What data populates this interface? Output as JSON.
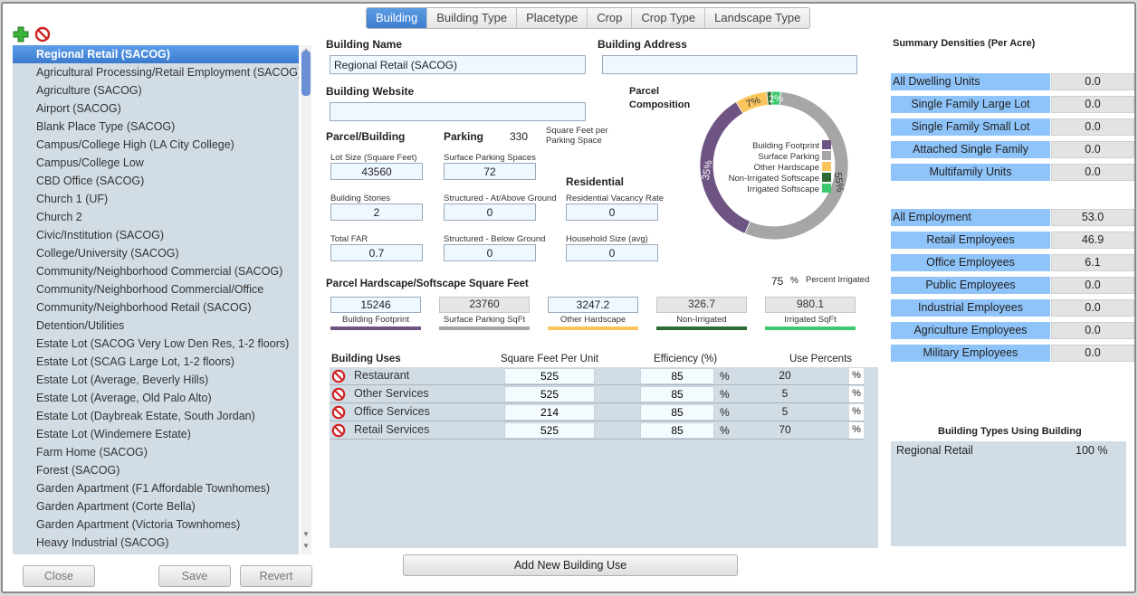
{
  "tabs": [
    "Building",
    "Building Type",
    "Placetype",
    "Crop",
    "Crop Type",
    "Landscape Type"
  ],
  "colors": {
    "accent": "#3d7fcf",
    "footprint": "#6e5482",
    "surface_parking": "#a6a6a6",
    "other_hardscape": "#fbc55d",
    "non_irrigated": "#2d6a36",
    "irrigated": "#3dc96e",
    "list_bg": "#d2dce4",
    "summary_key": "#8fc4fa"
  },
  "toolbar": {
    "add_icon": "plus-icon",
    "remove_icon": "no-entry-icon"
  },
  "list": {
    "items": [
      "Regional Retail (SACOG)",
      "Agricultural Processing/Retail Employment (SACOG)",
      "Agriculture (SACOG)",
      "Airport (SACOG)",
      "Blank Place Type (SACOG)",
      "Campus/College High (LA City College)",
      "Campus/College Low",
      "CBD Office (SACOG)",
      "Church 1 (UF)",
      "Church 2",
      "Civic/Institution (SACOG)",
      "College/University (SACOG)",
      "Community/Neighborhood Commercial (SACOG)",
      "Community/Neighborhood Commercial/Office",
      "Community/Neighborhood Retail (SACOG)",
      "Detention/Utilities",
      "Estate Lot (SACOG Very Low Den Res, 1-2 floors)",
      "Estate Lot (SCAG Large Lot, 1-2 floors)",
      "Estate Lot (Average, Beverly Hills)",
      "Estate Lot (Average, Old Palo Alto)",
      "Estate Lot (Daybreak Estate, South Jordan)",
      "Estate Lot (Windemere Estate)",
      "Farm Home (SACOG)",
      "Forest (SACOG)",
      "Garden Apartment (F1 Affordable Townhomes)",
      "Garden Apartment (Corte Bella)",
      "Garden Apartment (Victoria Townhomes)",
      "Heavy Industrial (SACOG)"
    ],
    "selected_index": 0
  },
  "footer": {
    "close": "Close",
    "save": "Save",
    "revert": "Revert"
  },
  "building": {
    "name_label": "Building Name",
    "name": "Regional Retail (SACOG)",
    "address_label": "Building Address",
    "address": "",
    "website_label": "Building Website",
    "website": "",
    "parcel_building_label": "Parcel/Building",
    "lot_size_label": "Lot Size (Square Feet)",
    "lot_size": "43560",
    "stories_label": "Building Stories",
    "stories": "2",
    "far_label": "Total FAR",
    "far": "0.7",
    "parking_label": "Parking",
    "parking_sqft": "330",
    "parking_unit": "Square Feet per Parking Space",
    "surface_spaces_label": "Surface Parking Spaces",
    "surface_spaces": "72",
    "structured_above_label": "Structured - At/Above Ground",
    "structured_above": "0",
    "structured_below_label": "Structured - Below Ground",
    "structured_below": "0",
    "residential_label": "Residential",
    "vacancy_label": "Residential Vacancy Rate",
    "vacancy": "0",
    "household_label": "Household Size (avg)",
    "household": "0"
  },
  "composition": {
    "title": "Parcel Composition",
    "legend": [
      "Building Footprint",
      "Surface Parking",
      "Other Hardscape",
      "Non-Irrigated Softscape",
      "Irrigated Softscape"
    ],
    "slices": [
      {
        "label": "Building Footprint",
        "value": 35
      },
      {
        "label": "Surface Parking",
        "value": 55
      },
      {
        "label": "Other Hardscape",
        "value": 7
      },
      {
        "label": "Non-Irrigated Softscape",
        "value": 1
      },
      {
        "label": "Irrigated Softscape",
        "value": 2
      }
    ],
    "pct_labels": {
      "footprint": "35%",
      "parking": "55%",
      "hardscape": "7%",
      "irrigated": "2%"
    }
  },
  "hardscape": {
    "title": "Parcel Hardscape/Softscape Square Feet",
    "percent_irrigated": "75",
    "percent_sign": "%",
    "percent_irrigated_label": "Percent Irrigated",
    "items": [
      {
        "label": "Building Footprint",
        "value": "15246"
      },
      {
        "label": "Surface Parking SqFt",
        "value": "23760"
      },
      {
        "label": "Other Hardscape",
        "value": "3247.2"
      },
      {
        "label": "Non-Irrigated",
        "value": "326.7"
      },
      {
        "label": "Irrigated SqFt",
        "value": "980.1"
      }
    ]
  },
  "uses": {
    "headers": [
      "Building Uses",
      "Square Feet Per Unit",
      "Efficiency (%)",
      "Use Percents"
    ],
    "rows": [
      {
        "name": "Restaurant",
        "sqft": "525",
        "eff": "85",
        "pct": "20"
      },
      {
        "name": "Other Services",
        "sqft": "525",
        "eff": "85",
        "pct": "5"
      },
      {
        "name": "Office Services",
        "sqft": "214",
        "eff": "85",
        "pct": "5"
      },
      {
        "name": "Retail Services",
        "sqft": "525",
        "eff": "85",
        "pct": "70"
      }
    ],
    "percent_sign": "%",
    "add_button": "Add New Building Use"
  },
  "summary": {
    "title": "Summary Densities (Per Acre)",
    "dwelling": [
      {
        "label": "All Dwelling Units",
        "value": "0.0"
      },
      {
        "label": "Single Family Large Lot",
        "value": "0.0"
      },
      {
        "label": "Single Family Small Lot",
        "value": "0.0"
      },
      {
        "label": "Attached Single Family",
        "value": "0.0"
      },
      {
        "label": "Multifamily Units",
        "value": "0.0"
      }
    ],
    "employment": [
      {
        "label": "All Employment",
        "value": "53.0"
      },
      {
        "label": "Retail Employees",
        "value": "46.9"
      },
      {
        "label": "Office Employees",
        "value": "6.1"
      },
      {
        "label": "Public Employees",
        "value": "0.0"
      },
      {
        "label": "Industrial Employees",
        "value": "0.0"
      },
      {
        "label": "Agriculture Employees",
        "value": "0.0"
      },
      {
        "label": "Military Employees",
        "value": "0.0"
      }
    ]
  },
  "building_types": {
    "title": "Building Types Using Building",
    "rows": [
      {
        "name": "Regional Retail",
        "pct": "100 %"
      }
    ]
  }
}
